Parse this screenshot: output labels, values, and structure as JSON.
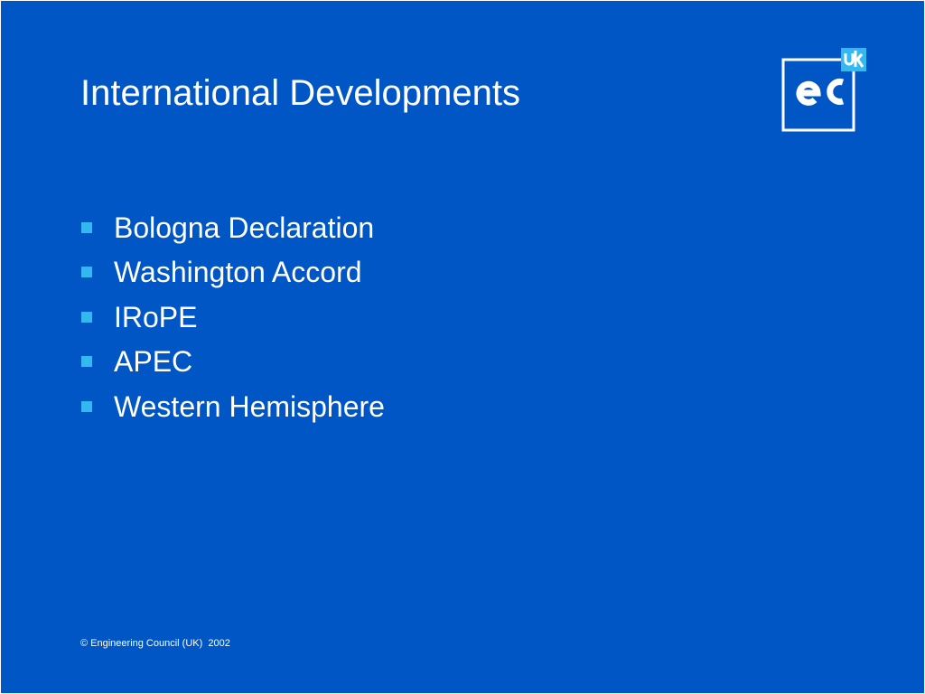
{
  "slide": {
    "title": "International Developments",
    "bullets": [
      "Bologna Declaration",
      "Washington Accord",
      "IRoPE",
      "APEC",
      "Western Hemisphere"
    ],
    "footer": "© Engineering Council (UK)  2002"
  },
  "logo": {
    "name": "ec-uk-logo",
    "main_text": "ec",
    "tag_text": "uk"
  },
  "colors": {
    "background": "#0056c4",
    "text": "#ffffff",
    "bullet": "#35b8f0",
    "logo_tag": "#35b8f0"
  }
}
